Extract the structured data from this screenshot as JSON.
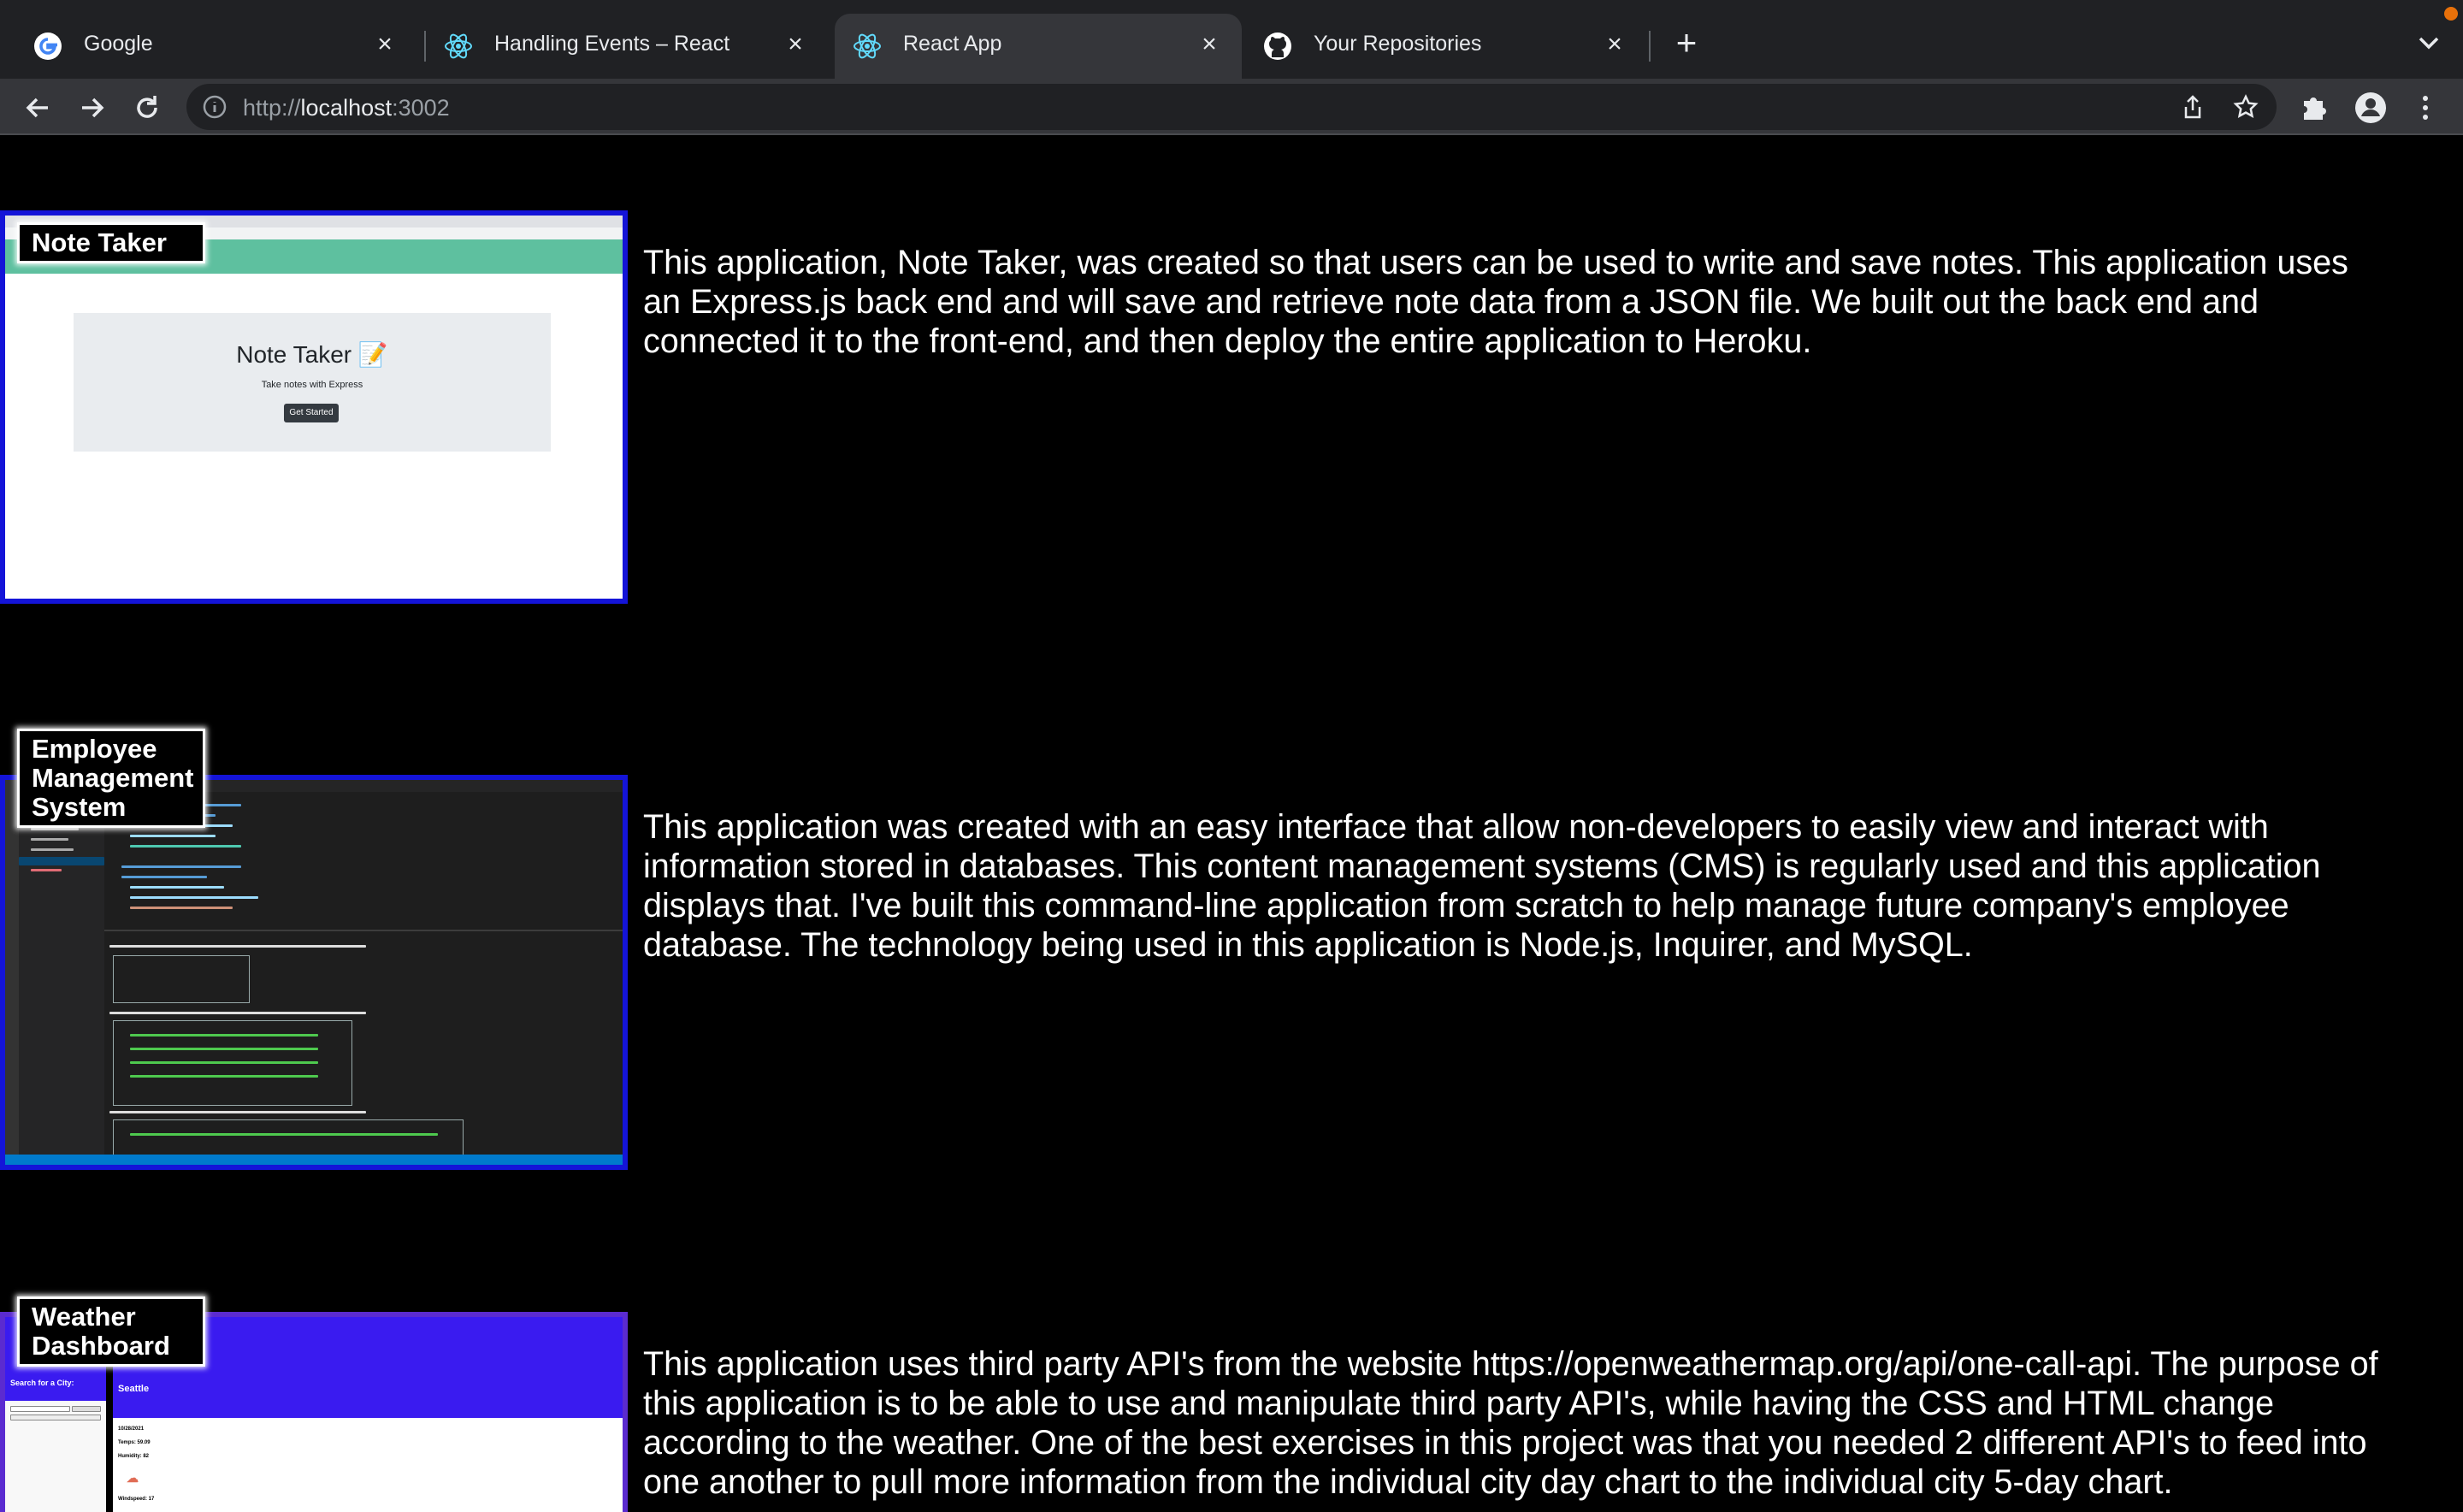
{
  "browser": {
    "tabs": [
      {
        "title": "Google",
        "icon": "google-icon"
      },
      {
        "title": "Handling Events – React",
        "icon": "react-icon"
      },
      {
        "title": "React App",
        "icon": "react-icon",
        "active": true
      },
      {
        "title": "Your Repositories",
        "icon": "github-icon"
      }
    ],
    "url_scheme": "http://",
    "url_host": "localhost",
    "url_port": ":3002"
  },
  "projects": [
    {
      "name": "Note Taker",
      "description": "This application, Note Taker, was created so that users can be used to write and save notes. This application uses an Express.js back end and will save and retrieve note data from a JSON file. We built out the back end and connected it to the front-end, and then deploy the entire application to Heroku.",
      "preview": {
        "title": "Note Taker 📝",
        "subtitle": "Take notes with Express",
        "button": "Get Started"
      }
    },
    {
      "name": "Employee Management System",
      "description": "This application was created with an easy interface that allow non-developers to easily view and interact with information stored in databases. This content management systems (CMS) is regularly used and this application displays that. I've built this command-line application from scratch to help manage future company's employee database. The technology being used in this application is Node.js, Inquirer, and MySQL."
    },
    {
      "name": "Weather Dashboard",
      "description": "This application uses third party API's from the website https://openweathermap.org/api/one-call-api. The purpose of this application is to be able to use and manipulate third party API's, while having the CSS and HTML change according to the weather. One of the best exercises in this project was that you needed 2 different API's to feed into one another to pull more information from the individual city day chart to the individual city 5-day chart.",
      "preview": {
        "search_label": "Search for a City:",
        "city": "Seattle",
        "date": "10/28/2021",
        "temp": "Temps: 59.09",
        "humidity": "Humidity: 82",
        "wind": "Windspeed: 17"
      }
    }
  ],
  "colors": {
    "thumb_border": "#1414d8",
    "weather_accent": "#3a1bf0",
    "note_nav": "#5ec09f"
  }
}
